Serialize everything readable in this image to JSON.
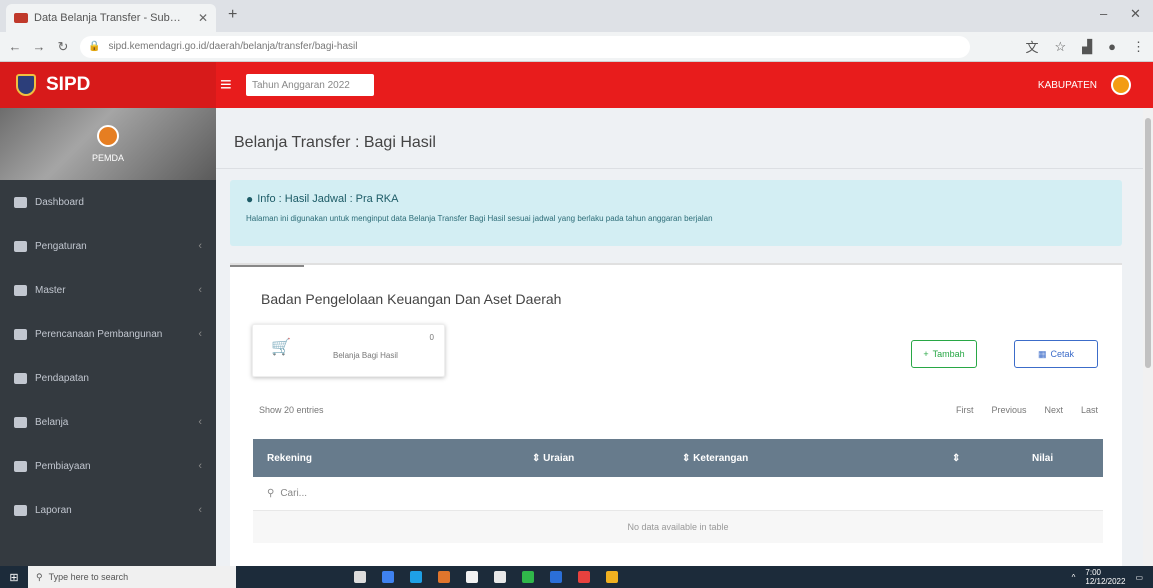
{
  "browser": {
    "tab_title": "Data Belanja Transfer - Sub…",
    "url": "sipd.kemendagri.go.id/daerah/belanja/transfer/bagi-hasil"
  },
  "header": {
    "brand": "SIPD",
    "year_select": "Tahun Anggaran 2022",
    "user": "KABUPATEN"
  },
  "sidebar": {
    "user_name": "PEMDA",
    "items": [
      {
        "label": "Dashboard",
        "chevron": false
      },
      {
        "label": "Pengaturan",
        "chevron": true
      },
      {
        "label": "Master",
        "chevron": true
      },
      {
        "label": "Perencanaan Pembangunan",
        "chevron": true
      },
      {
        "label": "Pendapatan",
        "chevron": false
      },
      {
        "label": "Belanja",
        "chevron": true
      },
      {
        "label": "Pembiayaan",
        "chevron": true
      },
      {
        "label": "Laporan",
        "chevron": true
      }
    ]
  },
  "content": {
    "page_title": "Belanja Transfer : Bagi Hasil",
    "alert_title": "Info : Hasil Jadwal : Pra RKA",
    "alert_text": "Halaman ini digunakan untuk menginput data Belanja Transfer Bagi Hasil sesuai jadwal yang berlaku pada tahun anggaran berjalan",
    "card_title": "Badan Pengelolaan Keuangan Dan Aset Daerah",
    "stat_label": "Belanja Bagi Hasil",
    "stat_value": "0",
    "add_button": "Tambah",
    "print_button": "Cetak",
    "show_entries": "Show 20 entries",
    "pagination": [
      "First",
      "Previous",
      "Next",
      "Last"
    ],
    "table": {
      "columns": [
        "Rekening",
        "Uraian",
        "Keterangan",
        "",
        "Nilai"
      ],
      "search_placeholder": "Cari...",
      "empty_text": "No data available in table"
    }
  },
  "taskbar": {
    "search_placeholder": "Type here to search",
    "time": "7:00",
    "date": "12/12/2022"
  },
  "colors": {
    "header_red": "#e81c1c",
    "sidebar_dark": "#343a40",
    "alert_bg": "#d3eef3",
    "table_header": "#677b8c",
    "btn_green": "#28a745",
    "btn_blue": "#3c6cc9"
  }
}
